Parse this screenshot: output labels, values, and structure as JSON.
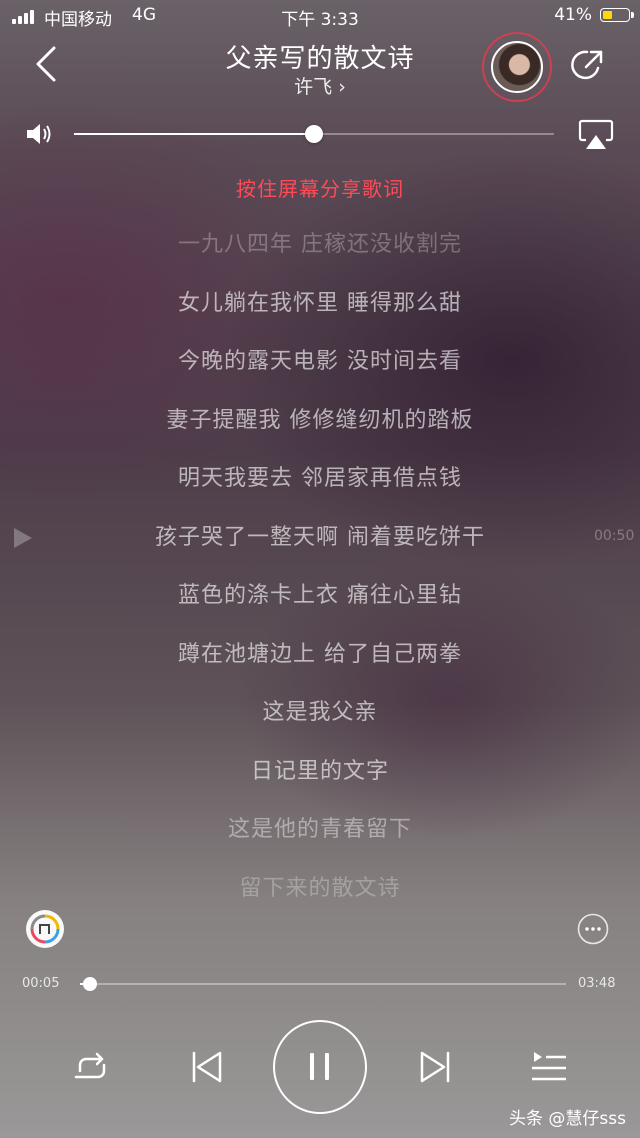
{
  "status_bar": {
    "carrier": "中国移动",
    "network": "4G",
    "time": "下午 3:33",
    "battery_percent": "41%",
    "battery_level": 0.41,
    "battery_color": "#ffd60a"
  },
  "header": {
    "title": "父亲写的散文诗",
    "artist": "许飞 ›",
    "back_icon": "chevron-left-icon",
    "share_icon": "share-icon"
  },
  "volume": {
    "level": 0.5
  },
  "lyrics": {
    "hint": "按住屏幕分享歌词",
    "lines": [
      "一九八四年 庄稼还没收割完",
      "女儿躺在我怀里 睡得那么甜",
      "今晚的露天电影 没时间去看",
      "妻子提醒我 修修缝纫机的踏板",
      "明天我要去 邻居家再借点钱",
      "孩子哭了一整天啊 闹着要吃饼干",
      "蓝色的涤卡上衣 痛往心里钻",
      "蹲在池塘边上 给了自己两拳",
      "这是我父亲",
      "日记里的文字",
      "这是他的青春留下",
      "留下来的散文诗"
    ],
    "side_time": "00:50"
  },
  "progress": {
    "elapsed": "00:05",
    "total": "03:48",
    "fraction": 0.02
  },
  "controls": {
    "repeat_icon": "repeat-icon",
    "prev_icon": "previous-icon",
    "pause_icon": "pause-icon",
    "next_icon": "next-icon",
    "playlist_icon": "playlist-icon"
  },
  "watermark": "头条 @慧仔sss",
  "colors": {
    "hint": "#ff4a57",
    "avatar_ring": "#e13c50"
  }
}
